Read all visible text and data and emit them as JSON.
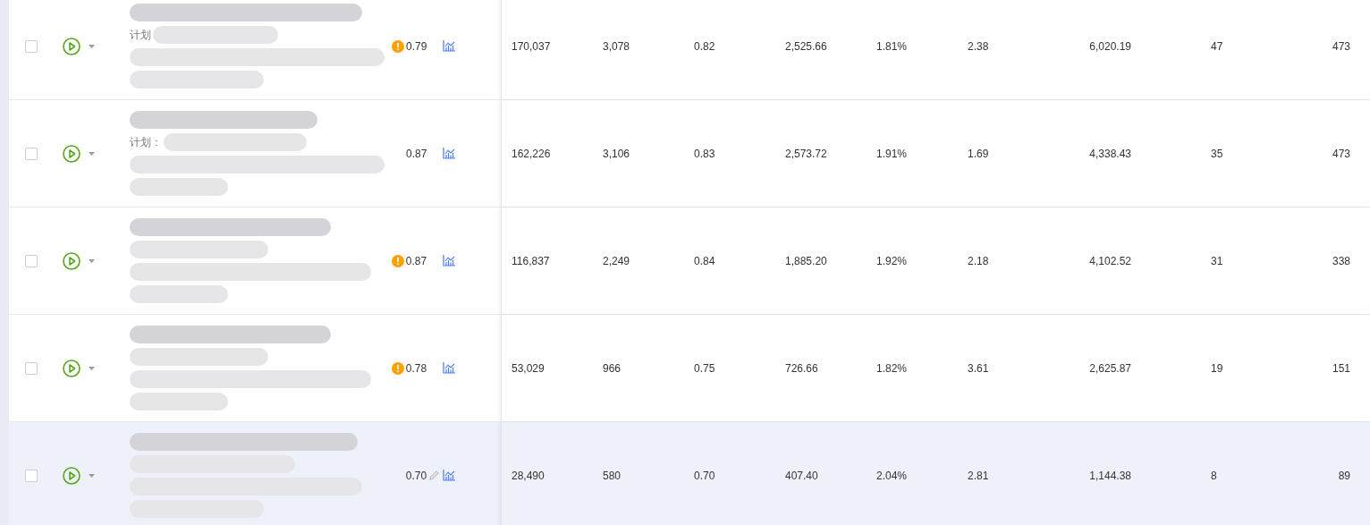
{
  "table": {
    "rows": [
      {
        "checked": false,
        "hovered": false,
        "warning": true,
        "plan_label": "计划",
        "score": "0.79",
        "values": [
          "170,037",
          "3,078",
          "0.82",
          "2,525.66",
          "1.81%",
          "2.38",
          "6,020.19",
          "47",
          "473"
        ]
      },
      {
        "checked": false,
        "hovered": false,
        "warning": false,
        "plan_label": "计划：",
        "score": "0.87",
        "values": [
          "162,226",
          "3,106",
          "0.83",
          "2,573.72",
          "1.91%",
          "1.69",
          "4,338.43",
          "35",
          "473"
        ]
      },
      {
        "checked": false,
        "hovered": false,
        "warning": true,
        "score": "0.87",
        "values": [
          "116,837",
          "2,249",
          "0.84",
          "1,885.20",
          "1.92%",
          "2.18",
          "4,102.52",
          "31",
          "338"
        ]
      },
      {
        "checked": false,
        "hovered": false,
        "warning": true,
        "score": "0.78",
        "values": [
          "53,029",
          "966",
          "0.75",
          "726.66",
          "1.82%",
          "3.61",
          "2,625.87",
          "19",
          "151"
        ]
      },
      {
        "checked": false,
        "hovered": true,
        "warning": false,
        "score": "0.70",
        "values": [
          "28,490",
          "580",
          "0.70",
          "407.40",
          "2.04%",
          "2.81",
          "1,144.38",
          "8",
          "89"
        ]
      }
    ]
  }
}
